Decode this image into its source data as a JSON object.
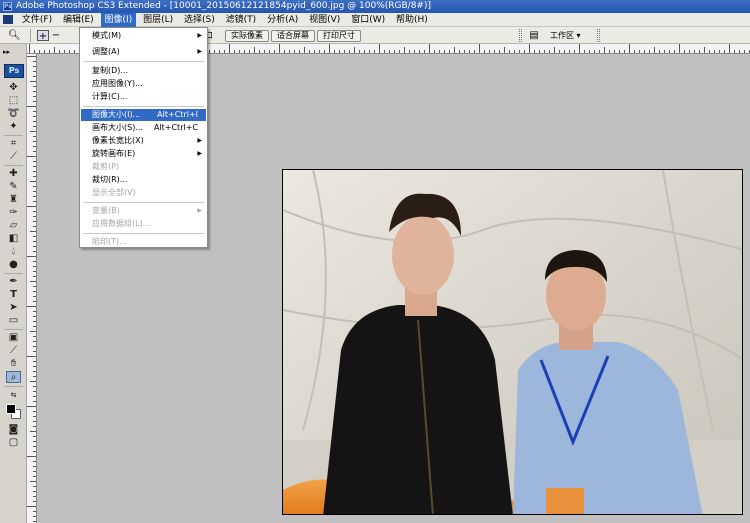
{
  "window": {
    "title": "Adobe Photoshop CS3 Extended - [10001_20150612121854pyid_600.jpg @ 100%(RGB/8#)]"
  },
  "menubar": {
    "items": [
      "文件(F)",
      "编辑(E)",
      "图像(I)",
      "图层(L)",
      "选择(S)",
      "滤镜(T)",
      "分析(A)",
      "视图(V)",
      "窗口(W)",
      "帮助(H)"
    ],
    "active_index": 2
  },
  "options": {
    "partial_label": "口",
    "buttons": [
      "实际像素",
      "适合屏幕",
      "打印尺寸"
    ],
    "workspace_label": "工作区 ▾"
  },
  "toolbox": {
    "logo": "Ps"
  },
  "image_menu": {
    "items": [
      {
        "label": "模式(M)",
        "submenu": true
      },
      {
        "label": "调整(A)",
        "submenu": true
      },
      {
        "label": "复制(D)..."
      },
      {
        "label": "应用图像(Y)..."
      },
      {
        "label": "计算(C)..."
      },
      {
        "label": "图像大小(I)...",
        "shortcut": "Alt+Ctrl+I",
        "highlighted": true
      },
      {
        "label": "画布大小(S)...",
        "shortcut": "Alt+Ctrl+C"
      },
      {
        "label": "像素长宽比(X)",
        "submenu": true
      },
      {
        "label": "旋转画布(E)",
        "submenu": true
      },
      {
        "label": "裁剪(P)",
        "disabled": true
      },
      {
        "label": "裁切(R)..."
      },
      {
        "label": "显示全部(V)",
        "disabled": true
      },
      {
        "label": "变量(B)",
        "submenu": true,
        "disabled": true
      },
      {
        "label": "应用数据组(L)...",
        "disabled": true
      },
      {
        "label": "陷印(T)...",
        "disabled": true
      }
    ]
  },
  "colors": {
    "menu_highlight": "#316ac5",
    "title_bar": "#2f62bd"
  }
}
